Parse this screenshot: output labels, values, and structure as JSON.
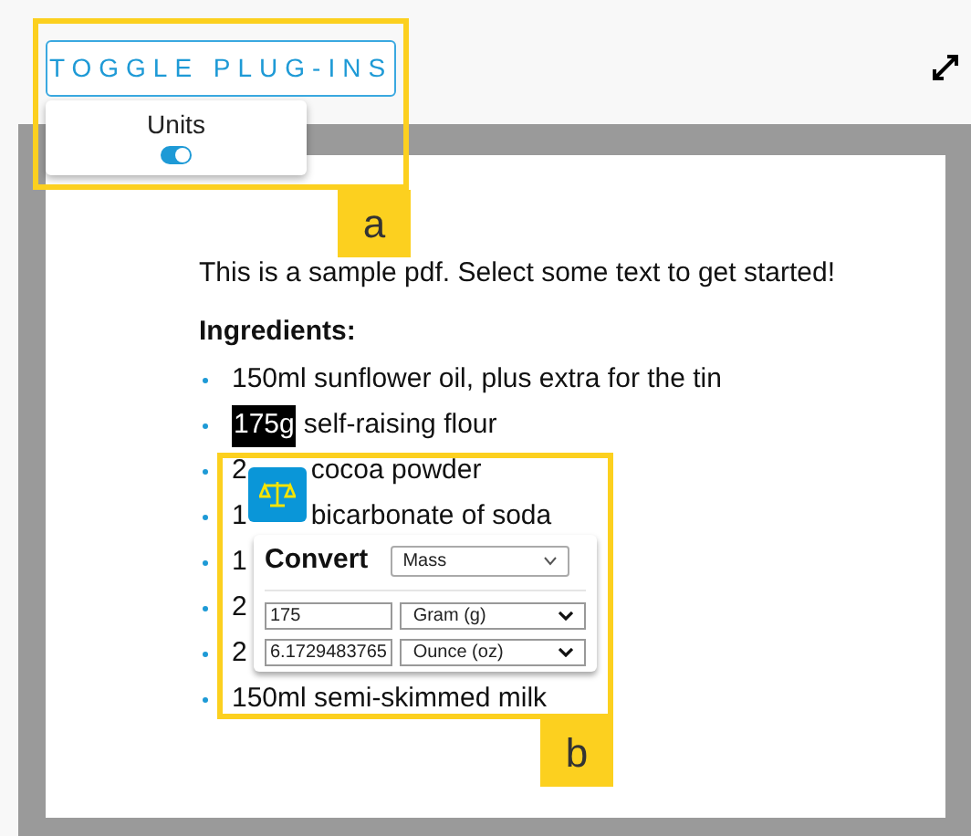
{
  "toolbar": {
    "toggle_button": "TOGGLE PLUG-INS",
    "plugins": [
      {
        "label": "Units",
        "on": true
      }
    ]
  },
  "document": {
    "intro": "This is a sample pdf. Select some text to get started!",
    "heading": "Ingredients:",
    "items": [
      {
        "parts": [
          "150ml sunflower oil, plus extra for the tin"
        ]
      },
      {
        "selected_text": "175g",
        "parts": [
          "self-raising flour"
        ]
      },
      {
        "parts": [
          "2",
          "cocoa powder"
        ]
      },
      {
        "parts": [
          "1",
          "bicarbonate of soda"
        ]
      },
      {
        "parts": [
          "1"
        ]
      },
      {
        "parts": [
          "2"
        ]
      },
      {
        "parts": [
          "2"
        ]
      },
      {
        "parts": [
          "150ml semi-skimmed milk"
        ]
      }
    ]
  },
  "convert_popup": {
    "title": "Convert",
    "category": "Mass",
    "rows": [
      {
        "value": "175",
        "unit": "Gram (g)"
      },
      {
        "value": "6.1729483765",
        "unit": "Ounce (oz)"
      }
    ]
  },
  "annotations": [
    {
      "label": "a"
    },
    {
      "label": "b"
    }
  ]
}
